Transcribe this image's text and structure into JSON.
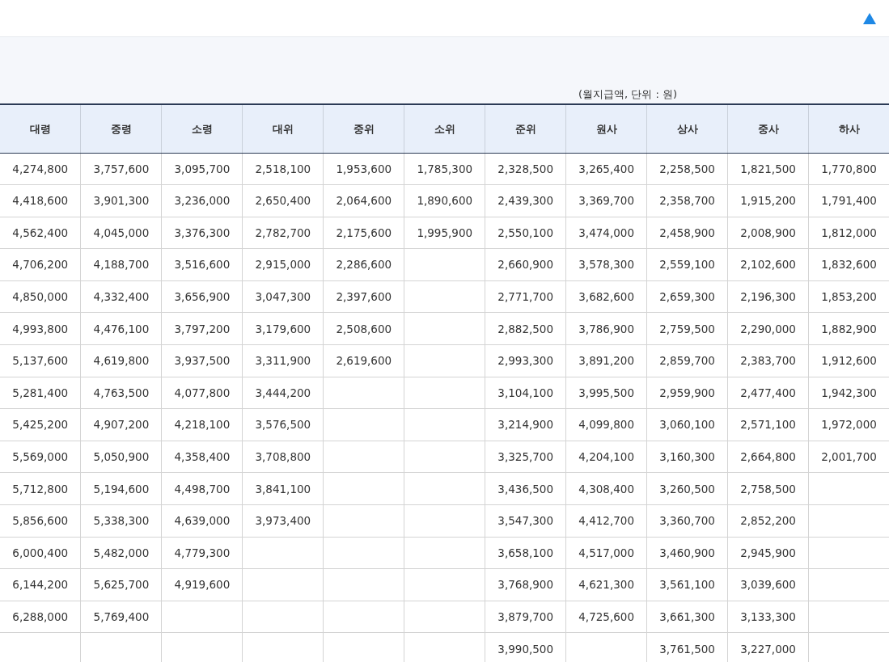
{
  "caption": "(월지급액, 단위 : 원)",
  "table": {
    "columns": [
      "대령",
      "중령",
      "소령",
      "대위",
      "중위",
      "소위",
      "준위",
      "원사",
      "상사",
      "중사",
      "하사"
    ],
    "rows": [
      [
        "4,274,800",
        "3,757,600",
        "3,095,700",
        "2,518,100",
        "1,953,600",
        "1,785,300",
        "2,328,500",
        "3,265,400",
        "2,258,500",
        "1,821,500",
        "1,770,800"
      ],
      [
        "4,418,600",
        "3,901,300",
        "3,236,000",
        "2,650,400",
        "2,064,600",
        "1,890,600",
        "2,439,300",
        "3,369,700",
        "2,358,700",
        "1,915,200",
        "1,791,400"
      ],
      [
        "4,562,400",
        "4,045,000",
        "3,376,300",
        "2,782,700",
        "2,175,600",
        "1,995,900",
        "2,550,100",
        "3,474,000",
        "2,458,900",
        "2,008,900",
        "1,812,000"
      ],
      [
        "4,706,200",
        "4,188,700",
        "3,516,600",
        "2,915,000",
        "2,286,600",
        null,
        "2,660,900",
        "3,578,300",
        "2,559,100",
        "2,102,600",
        "1,832,600"
      ],
      [
        "4,850,000",
        "4,332,400",
        "3,656,900",
        "3,047,300",
        "2,397,600",
        null,
        "2,771,700",
        "3,682,600",
        "2,659,300",
        "2,196,300",
        "1,853,200"
      ],
      [
        "4,993,800",
        "4,476,100",
        "3,797,200",
        "3,179,600",
        "2,508,600",
        null,
        "2,882,500",
        "3,786,900",
        "2,759,500",
        "2,290,000",
        "1,882,900"
      ],
      [
        "5,137,600",
        "4,619,800",
        "3,937,500",
        "3,311,900",
        "2,619,600",
        null,
        "2,993,300",
        "3,891,200",
        "2,859,700",
        "2,383,700",
        "1,912,600"
      ],
      [
        "5,281,400",
        "4,763,500",
        "4,077,800",
        "3,444,200",
        null,
        null,
        "3,104,100",
        "3,995,500",
        "2,959,900",
        "2,477,400",
        "1,942,300"
      ],
      [
        "5,425,200",
        "4,907,200",
        "4,218,100",
        "3,576,500",
        null,
        null,
        "3,214,900",
        "4,099,800",
        "3,060,100",
        "2,571,100",
        "1,972,000"
      ],
      [
        "5,569,000",
        "5,050,900",
        "4,358,400",
        "3,708,800",
        null,
        null,
        "3,325,700",
        "4,204,100",
        "3,160,300",
        "2,664,800",
        "2,001,700"
      ],
      [
        "5,712,800",
        "5,194,600",
        "4,498,700",
        "3,841,100",
        null,
        null,
        "3,436,500",
        "4,308,400",
        "3,260,500",
        "2,758,500",
        null
      ],
      [
        "5,856,600",
        "5,338,300",
        "4,639,000",
        "3,973,400",
        null,
        null,
        "3,547,300",
        "4,412,700",
        "3,360,700",
        "2,852,200",
        null
      ],
      [
        "6,000,400",
        "5,482,000",
        "4,779,300",
        null,
        null,
        null,
        "3,658,100",
        "4,517,000",
        "3,460,900",
        "2,945,900",
        null
      ],
      [
        "6,144,200",
        "5,625,700",
        "4,919,600",
        null,
        null,
        null,
        "3,768,900",
        "4,621,300",
        "3,561,100",
        "3,039,600",
        null
      ],
      [
        "6,288,000",
        "5,769,400",
        null,
        null,
        null,
        null,
        "3,879,700",
        "4,725,600",
        "3,661,300",
        "3,133,300",
        null
      ],
      [
        null,
        null,
        null,
        null,
        null,
        null,
        "3,990,500",
        null,
        "3,761,500",
        "3,227,000",
        null
      ]
    ]
  }
}
